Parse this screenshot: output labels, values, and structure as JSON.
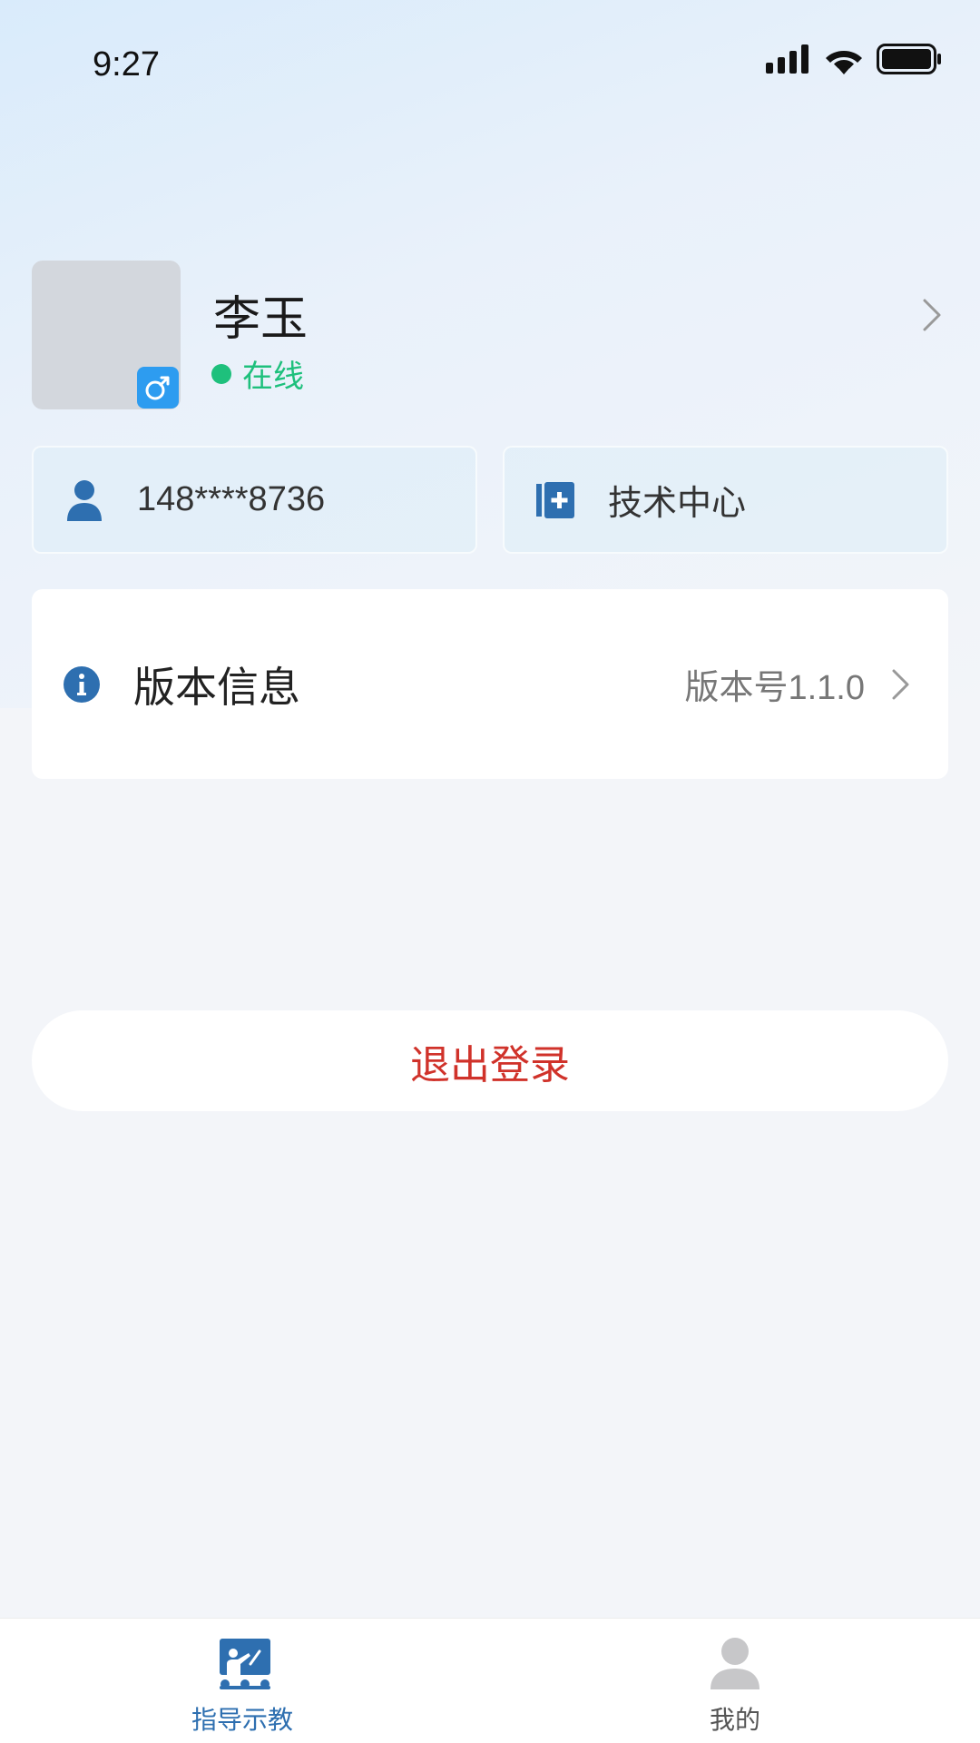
{
  "status_bar": {
    "time": "9:27"
  },
  "profile": {
    "name": "李玉",
    "status": "在线"
  },
  "cards": {
    "phone": "148****8736",
    "department": "技术中心"
  },
  "version": {
    "title": "版本信息",
    "value": "版本号1.1.0"
  },
  "logout_label": "退出登录",
  "tabs": [
    {
      "label": "指导示教",
      "active": true
    },
    {
      "label": "我的",
      "active": false
    }
  ],
  "colors": {
    "accent": "#2e6fb0",
    "online": "#1ec07c",
    "logout": "#d0322a",
    "badge": "#2d9cf0"
  },
  "icons": {
    "signal": "signal-icon",
    "wifi": "wifi-icon",
    "battery": "battery-icon",
    "gender": "male-icon",
    "phone": "user-icon",
    "department": "department-icon",
    "version": "info-icon",
    "tab_teach": "teaching-icon",
    "tab_me": "profile-icon"
  }
}
